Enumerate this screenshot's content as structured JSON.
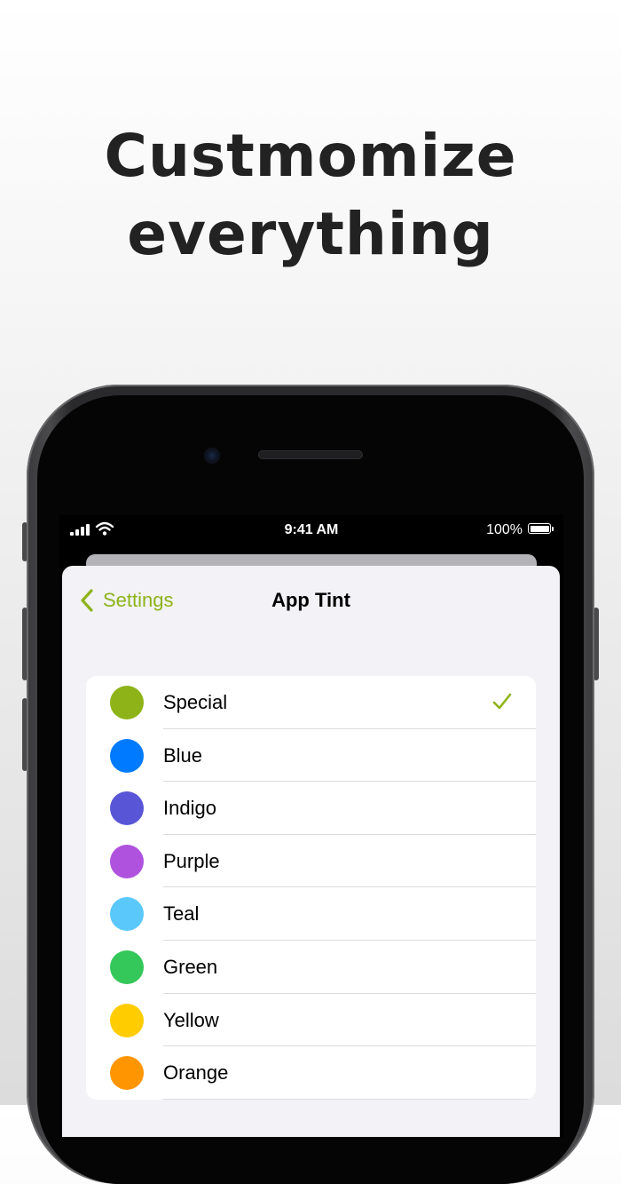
{
  "headline": {
    "line1": "Custmomize",
    "line2": "everything"
  },
  "status_bar": {
    "time": "9:41 AM",
    "battery": "100%"
  },
  "nav": {
    "back_label": "Settings",
    "title": "App Tint"
  },
  "accent_color": "#8db318",
  "tints": [
    {
      "label": "Special",
      "color": "#8db318",
      "selected": true
    },
    {
      "label": "Blue",
      "color": "#007aff",
      "selected": false
    },
    {
      "label": "Indigo",
      "color": "#5856d6",
      "selected": false
    },
    {
      "label": "Purple",
      "color": "#af52de",
      "selected": false
    },
    {
      "label": "Teal",
      "color": "#5ac8fa",
      "selected": false
    },
    {
      "label": "Green",
      "color": "#34c759",
      "selected": false
    },
    {
      "label": "Yellow",
      "color": "#ffcc00",
      "selected": false
    },
    {
      "label": "Orange",
      "color": "#ff9500",
      "selected": false
    }
  ],
  "icons": {
    "back": "chevron-left-icon",
    "selected": "checkmark-icon",
    "signal": "cellular-signal-icon",
    "wifi": "wifi-icon",
    "battery": "battery-icon"
  }
}
